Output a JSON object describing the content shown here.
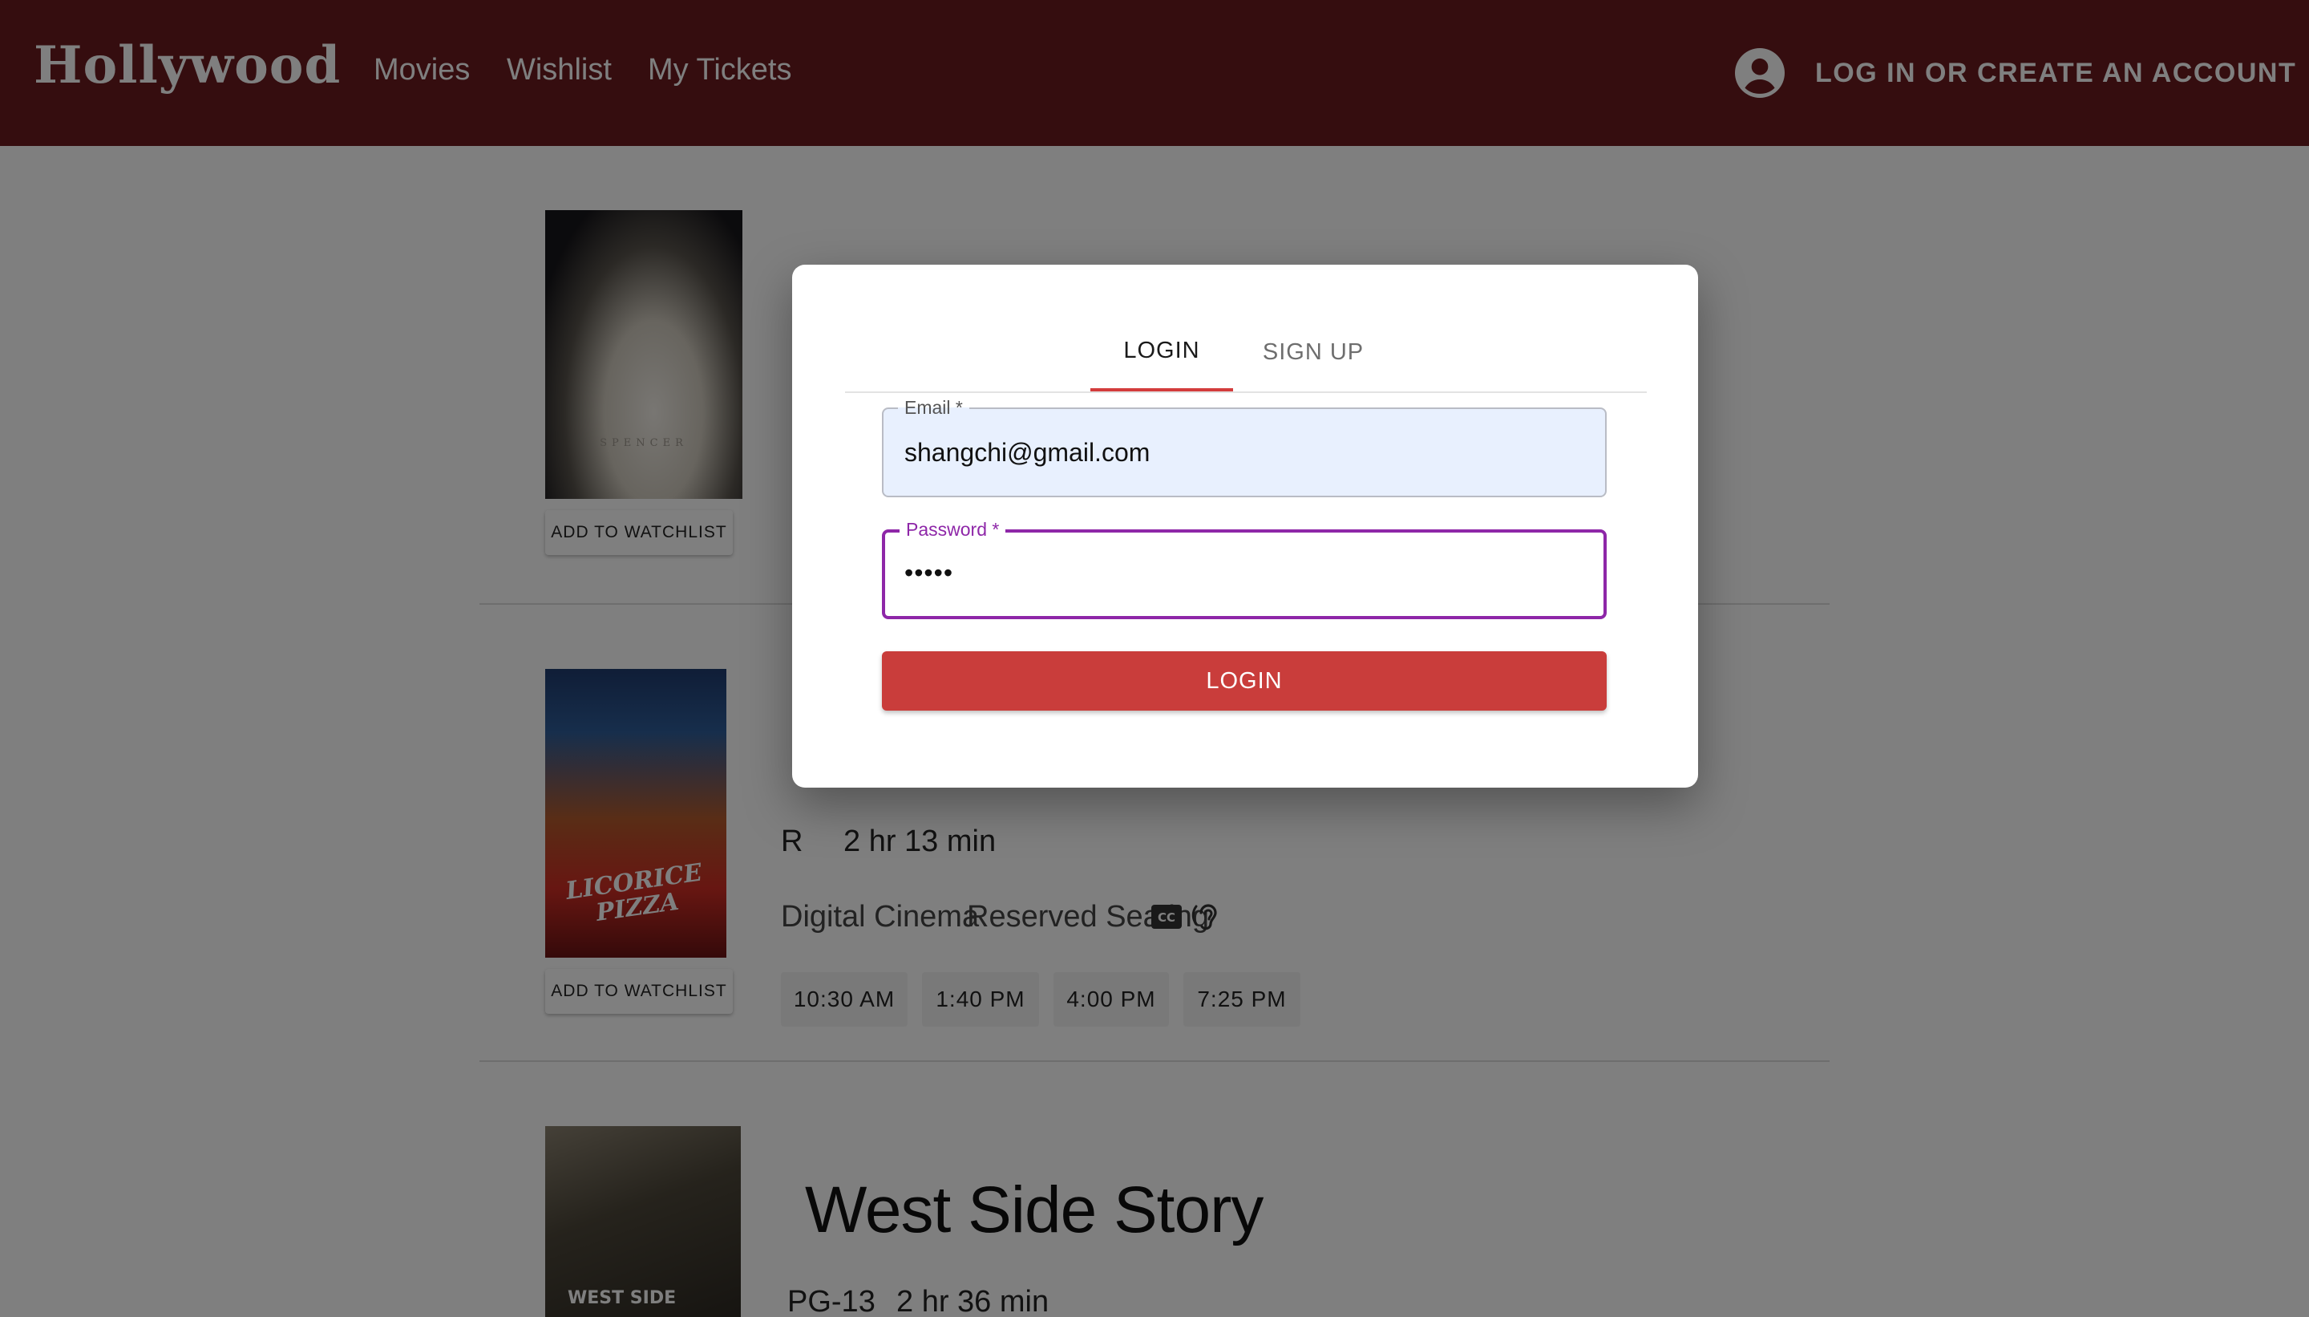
{
  "header": {
    "logo": "Hollywood",
    "nav": [
      "Movies",
      "Wishlist",
      "My Tickets"
    ],
    "account_label": "LOG IN OR CREATE AN ACCOUNT"
  },
  "movies": [
    {
      "poster_text": "SPENCER",
      "watchlist_label": "ADD TO WATCHLIST"
    },
    {
      "poster_text": "LICORICE PIZZA",
      "watchlist_label": "ADD TO WATCHLIST",
      "rating": "R",
      "runtime": "2 hr 13 min",
      "format": "Digital Cinema",
      "seating": "Reserved Seating",
      "accessibility_icons": [
        "closed-captions-icon",
        "hearing-assist-icon"
      ],
      "showtimes": [
        "10:30 AM",
        "1:40 PM",
        "4:00 PM",
        "7:25 PM"
      ]
    },
    {
      "poster_text": "WEST SIDE",
      "title": "West Side Story",
      "rating": "PG-13",
      "runtime": "2 hr 36 min"
    }
  ],
  "dialog": {
    "tabs": [
      "LOGIN",
      "SIGN UP"
    ],
    "active_tab": "LOGIN",
    "email": {
      "label": "Email *",
      "value": "shangchi@gmail.com"
    },
    "password": {
      "label": "Password *",
      "value": "•••••"
    },
    "submit_label": "LOGIN"
  },
  "colors": {
    "header_bg": "#6a1b1f",
    "tab_indicator": "#d33c3c",
    "focused_field": "#8e27a8",
    "login_button": "#c93d3b",
    "autofill_bg": "#e8f0fe"
  }
}
